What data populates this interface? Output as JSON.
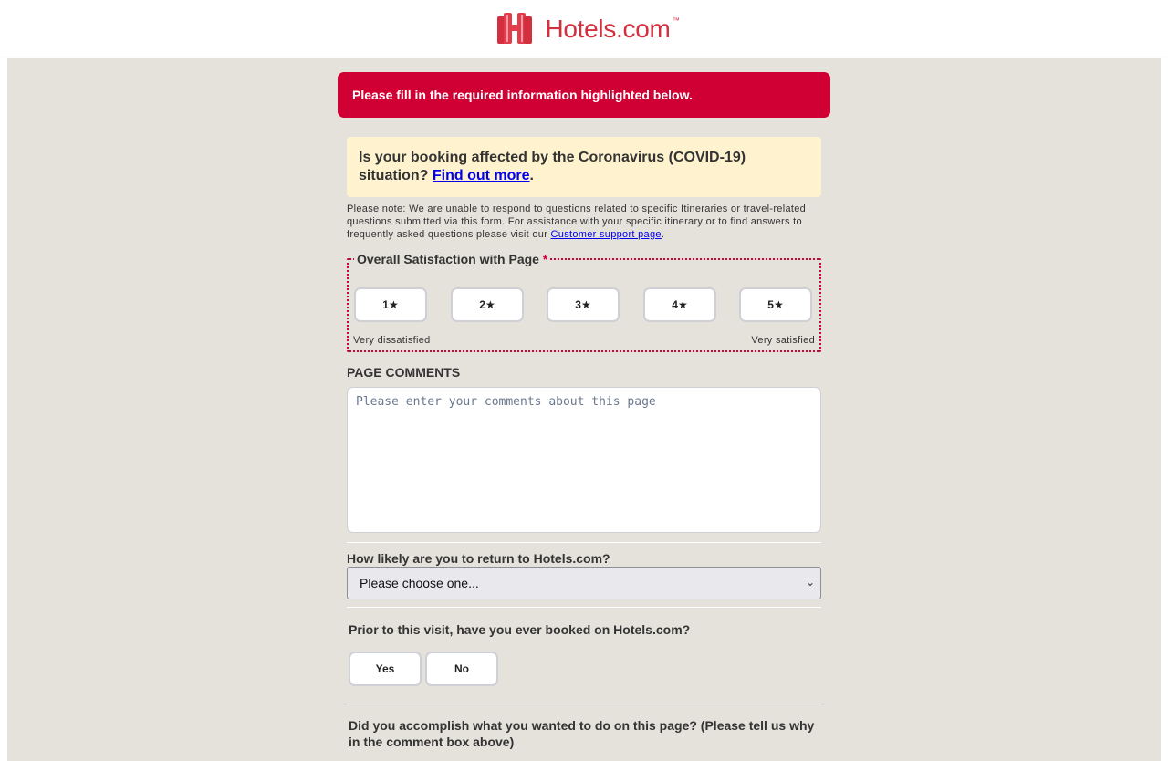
{
  "brand": {
    "name": "Hotels.com",
    "trademark": "™",
    "color": "#d32f3f"
  },
  "error": {
    "message": "Please fill in the required information highlighted below."
  },
  "covid": {
    "text": "Is your booking affected by the Coronavirus (COVID-19) situation?",
    "link": "Find out more",
    "suffix": "."
  },
  "note": {
    "text": "Please note: We are unable to respond to questions related to specific Itineraries or travel-related questions submitted via this form. For assistance with your specific itinerary or to find answers to frequently asked questions please visit our",
    "link": "Customer support page",
    "suffix": "."
  },
  "rating": {
    "legend": "Overall Satisfaction with Page",
    "required_marker": "*",
    "options": [
      "1★",
      "2★",
      "3★",
      "4★",
      "5★"
    ],
    "low_label": "Very dissatisfied",
    "high_label": "Very satisfied"
  },
  "comments": {
    "title": "PAGE COMMENTS",
    "placeholder": "Please enter your comments about this page",
    "value": ""
  },
  "return_question": {
    "label": "How likely are you to return to Hotels.com?",
    "selected": "Please choose one..."
  },
  "booked_question": {
    "label": "Prior to this visit, have you ever booked on Hotels.com?",
    "options": [
      "Yes",
      "No"
    ]
  },
  "accomplish_question": {
    "label": "Did you accomplish what you wanted to do on this page? (Please tell us why in the comment box above)"
  },
  "colors": {
    "error_bg": "#d10034",
    "notice_bg": "#fff3cf",
    "page_bg": "#e5e2dc",
    "link": "#0000ee"
  }
}
